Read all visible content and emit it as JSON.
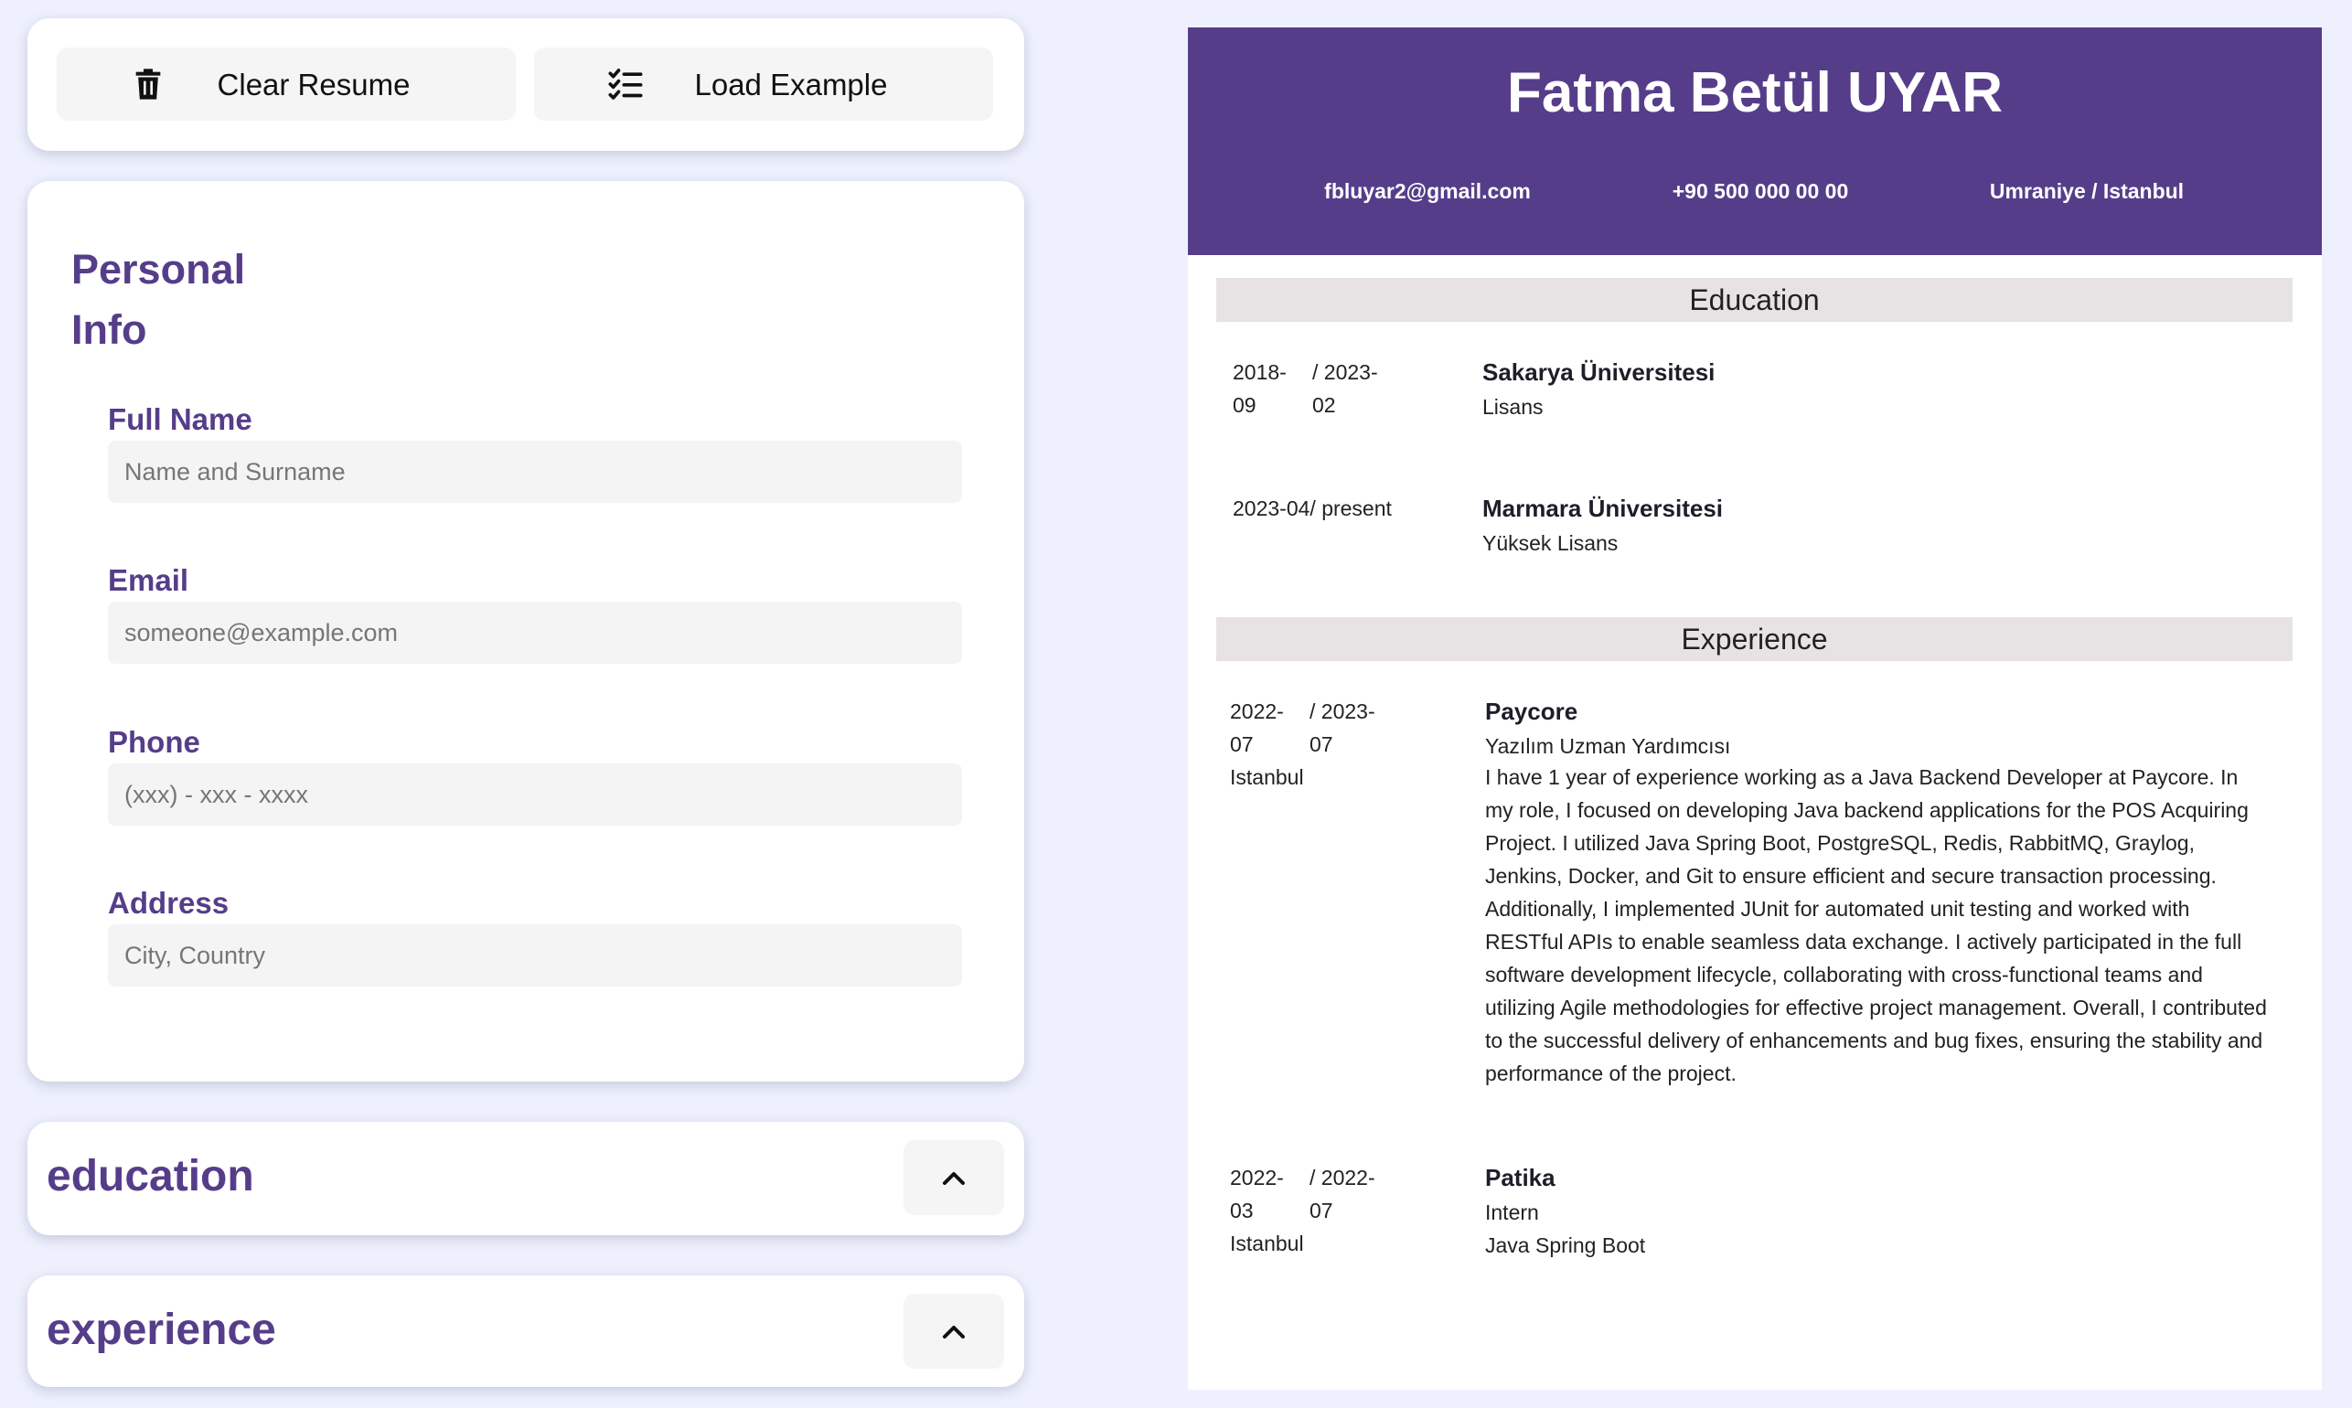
{
  "toolbar": {
    "clear_label": "Clear Resume",
    "load_label": "Load Example"
  },
  "personal": {
    "title_line1": "Personal",
    "title_line2": "Info",
    "full_name": {
      "label": "Full Name",
      "placeholder": "Name and Surname",
      "value": ""
    },
    "email": {
      "label": "Email",
      "placeholder": "someone@example.com",
      "value": ""
    },
    "phone": {
      "label": "Phone",
      "placeholder": "(xxx) - xxx - xxxx",
      "value": ""
    },
    "address": {
      "label": "Address",
      "placeholder": "City, Country",
      "value": ""
    }
  },
  "sections": {
    "education_title": "education",
    "experience_title": "experience"
  },
  "resume": {
    "name": "Fatma Betül UYAR",
    "email": "fbluyar2@gmail.com",
    "phone": "+90 500 000 00 00",
    "address": "Umraniye / Istanbul",
    "education_heading": "Education",
    "experience_heading": "Experience",
    "education": [
      {
        "start_a": "2018-",
        "start_b": "09",
        "end_a": "/ 2023-",
        "end_b": "02",
        "school": "Sakarya Üniversitesi",
        "degree": "Lisans"
      },
      {
        "range": "2023-04/ present",
        "school": "Marmara Üniversitesi",
        "degree": "Yüksek Lisans"
      }
    ],
    "experience": [
      {
        "start_a": "2022-",
        "start_b": "07",
        "end_a": "/ 2023-",
        "end_b": "07",
        "location": "Istanbul",
        "company": "Paycore",
        "position": "Yazılım Uzman Yardımcısı",
        "description": "I have 1 year of experience working as a Java Backend Developer at Paycore. In my role, I focused on developing Java backend applications for the POS Acquiring Project. I utilized Java Spring Boot, PostgreSQL, Redis, RabbitMQ, Graylog, Jenkins, Docker, and Git to ensure efficient and secure transaction processing. Additionally, I implemented JUnit for automated unit testing and worked with RESTful APIs to enable seamless data exchange. I actively participated in the full software development lifecycle, collaborating with cross-functional teams and utilizing Agile methodologies for effective project management. Overall, I contributed to the successful delivery of enhancements and bug fixes, ensuring the stability and performance of the project."
      },
      {
        "start_a": "2022-",
        "start_b": "03",
        "end_a": "/ 2022-",
        "end_b": "07",
        "location": "Istanbul",
        "company": "Patika",
        "position": "Intern",
        "description": "Java Spring Boot"
      }
    ]
  },
  "colors": {
    "accent": "#563d8a",
    "page_background": "#eef1fd",
    "section_band": "#e7e2e4"
  },
  "icons": {
    "clear": "trash-icon",
    "load": "checklist-icon",
    "collapse": "chevron-up-icon"
  }
}
